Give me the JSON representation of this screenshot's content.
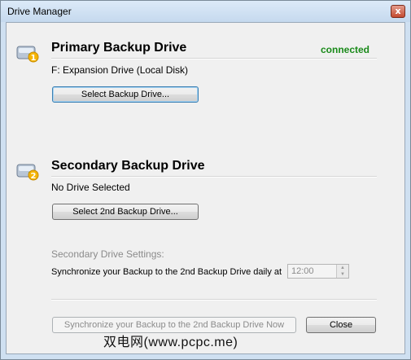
{
  "window": {
    "title": "Drive Manager",
    "close_glyph": "x"
  },
  "primary": {
    "heading": "Primary Backup Drive",
    "status": "connected",
    "status_color": "#1a8a1a",
    "drive_text": "F: Expansion Drive (Local Disk)",
    "button_label": "Select Backup Drive...",
    "icon": "drive-1-icon"
  },
  "secondary": {
    "heading": "Secondary Backup Drive",
    "drive_text": "No Drive Selected",
    "button_label": "Select 2nd Backup Drive...",
    "icon": "drive-2-icon",
    "settings_heading": "Secondary Drive Settings:",
    "sync_label": "Synchronize your Backup to the 2nd Backup Drive daily at",
    "time_value": "12:00"
  },
  "footer": {
    "sync_now_label": "Synchronize your Backup to the 2nd Backup Drive Now",
    "close_label": "Close"
  },
  "watermark": "双电网(www.pcpc.me)"
}
